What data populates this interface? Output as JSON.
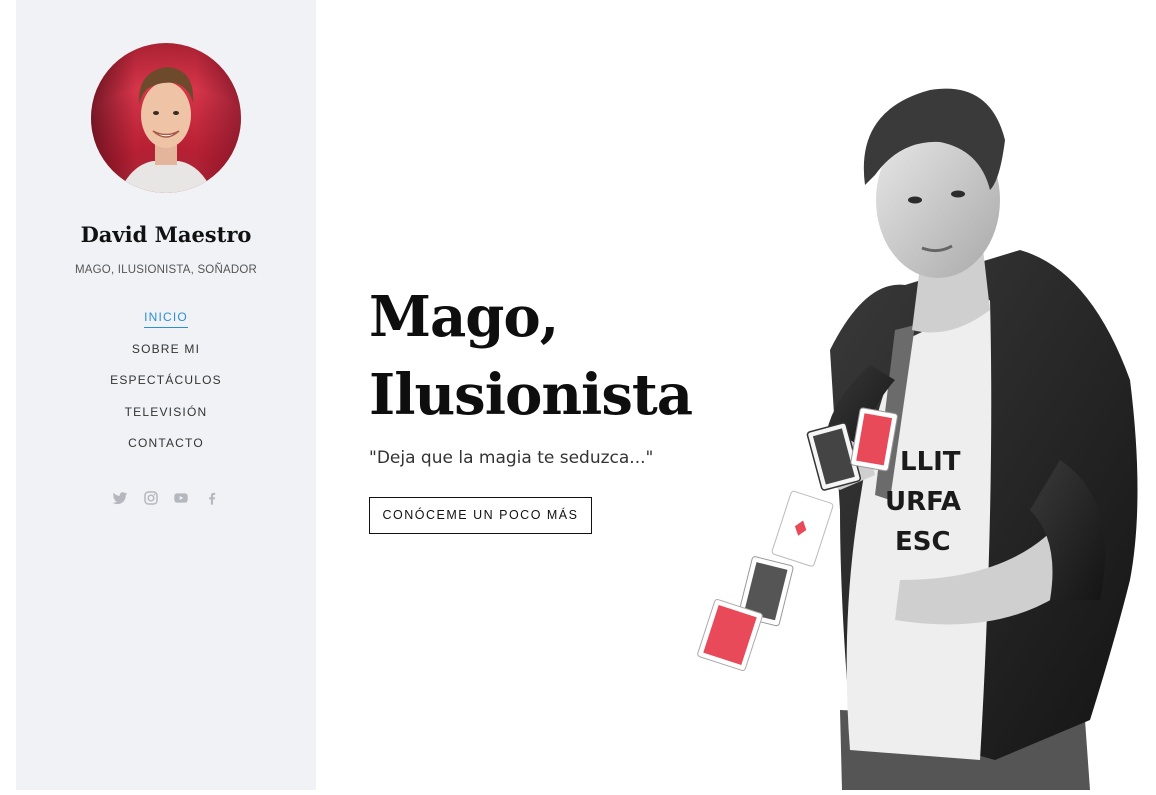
{
  "sidebar": {
    "name": "David Maestro",
    "tagline": "MAGO, ILUSIONISTA, SOÑADOR",
    "nav": [
      {
        "label": "INICIO",
        "active": true
      },
      {
        "label": "SOBRE MI",
        "active": false
      },
      {
        "label": "ESPECTÁCULOS",
        "active": false
      },
      {
        "label": "TELEVISIÓN",
        "active": false
      },
      {
        "label": "CONTACTO",
        "active": false
      }
    ],
    "social": [
      "twitter-icon",
      "instagram-icon",
      "youtube-icon",
      "facebook-icon"
    ]
  },
  "hero": {
    "title_line1": "Mago,",
    "title_line2": "Ilusionista",
    "quote": "\"Deja que la magia te seduzca...\"",
    "cta_label": "CONÓCEME UN POCO MÁS"
  },
  "colors": {
    "accent": "#2c8fd6",
    "sidebar_bg": "#f1f2f6",
    "text_dark": "#0e0e0e",
    "icon_gray": "#b4b7bd",
    "card_red": "#e84a5a"
  }
}
